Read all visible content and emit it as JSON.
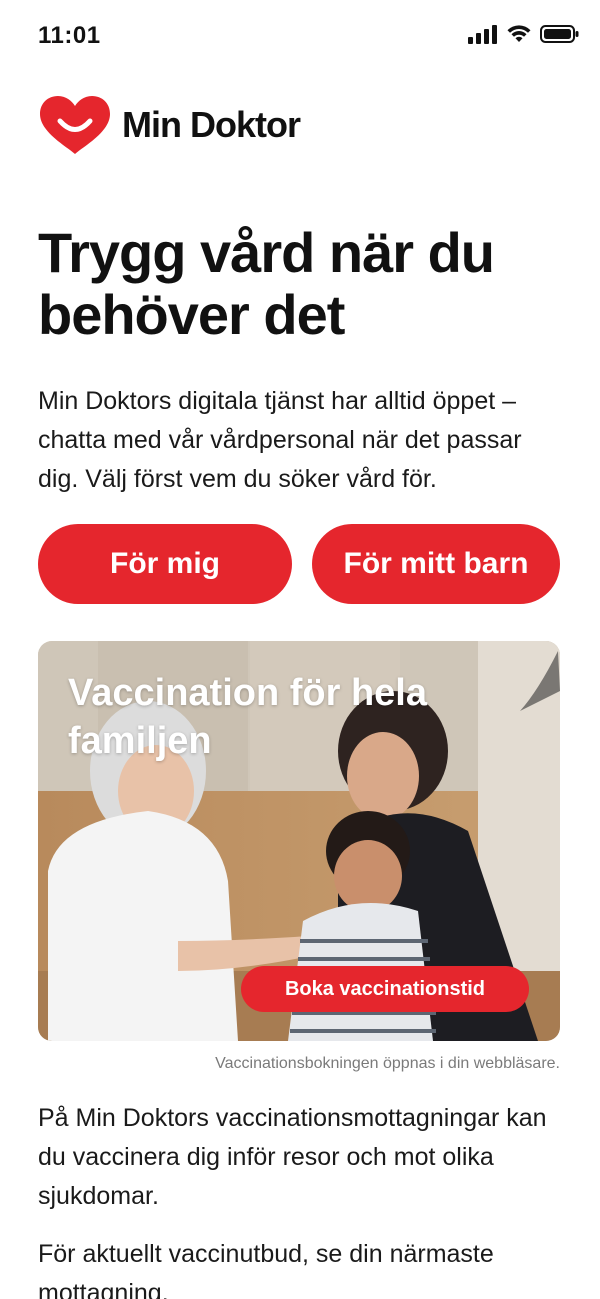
{
  "status_bar": {
    "time": "11:01",
    "icons": [
      "signal-icon",
      "wifi-icon",
      "battery-icon"
    ]
  },
  "logo": {
    "text": "Min Doktor",
    "icon": "heart-smile-logo-icon",
    "color": "#e5262d"
  },
  "hero": {
    "title": "Trygg vård när du behöver det",
    "text": "Min Doktors digitala tjänst har alltid öppet – chatta med vår vårdpersonal när det passar dig. Välj först vem du söker vård för."
  },
  "buttons": {
    "for_me": "För mig",
    "for_child": "För mitt barn"
  },
  "promo": {
    "title": "Vaccination för hela familjen",
    "button_label": "Boka vaccinationstid",
    "note": "Vaccinationsbokningen öppnas i din webbläsare."
  },
  "body": {
    "paragraph_1": "På Min Doktors vaccinationsmottagningar kan du vaccinera dig inför resor och mot olika sjukdomar.",
    "paragraph_2": "För aktuellt vaccinutbud, se din närmaste mottagning."
  },
  "colors": {
    "accent": "#e5262d",
    "text": "#111111",
    "muted": "#7a7a7a"
  }
}
